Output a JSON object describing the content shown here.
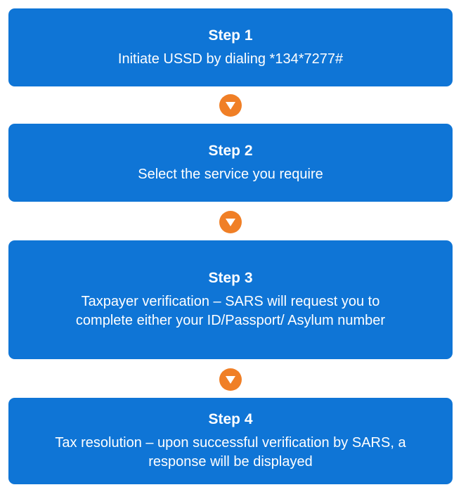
{
  "steps": [
    {
      "title": "Step 1",
      "description": "Initiate USSD by dialing *134*7277#"
    },
    {
      "title": "Step 2",
      "description": "Select the service you require"
    },
    {
      "title": "Step 3",
      "description": "Taxpayer verification – SARS will request you to complete either your ID/Passport/ Asylum number"
    },
    {
      "title": "Step 4",
      "description": "Tax resolution – upon successful verification by SARS, a response will be displayed"
    }
  ],
  "connector_icon": "down-triangle-icon",
  "colors": {
    "box": "#0f75d6",
    "box_text": "#ffffff",
    "connector": "#f07f26"
  }
}
